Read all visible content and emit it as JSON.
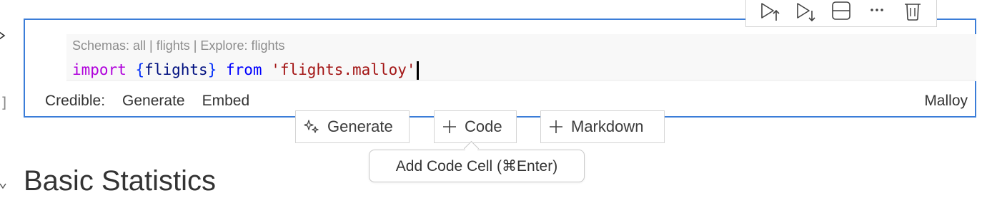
{
  "cell": {
    "codelens": "Schemas: all | flights | Explore: flights",
    "code": {
      "keyword": "import",
      "brace_open": "{",
      "identifier": "flights",
      "brace_close": "}",
      "from": "from",
      "string": "'flights.malloy'"
    },
    "status": {
      "credible": "Credible:",
      "generate": "Generate",
      "embed": "Embed"
    },
    "language": "Malloy"
  },
  "toolbar": {
    "icons": [
      "execute-above-icon",
      "execute-below-icon",
      "split-cell-icon",
      "more-icon",
      "delete-icon"
    ]
  },
  "insert": {
    "generate_label": "Generate",
    "code_label": "Code",
    "markdown_label": "Markdown"
  },
  "tooltip": {
    "text": "Add Code Cell (⌘Enter)"
  },
  "next_cell": {
    "heading": "Basic Statistics"
  },
  "gutter": {
    "bracket": "]"
  },
  "colors": {
    "focus_border": "#3b7dd8",
    "keyword": "#af00db",
    "string": "#a31515",
    "identifier": "#001080",
    "keyword_control": "#0000ff"
  }
}
